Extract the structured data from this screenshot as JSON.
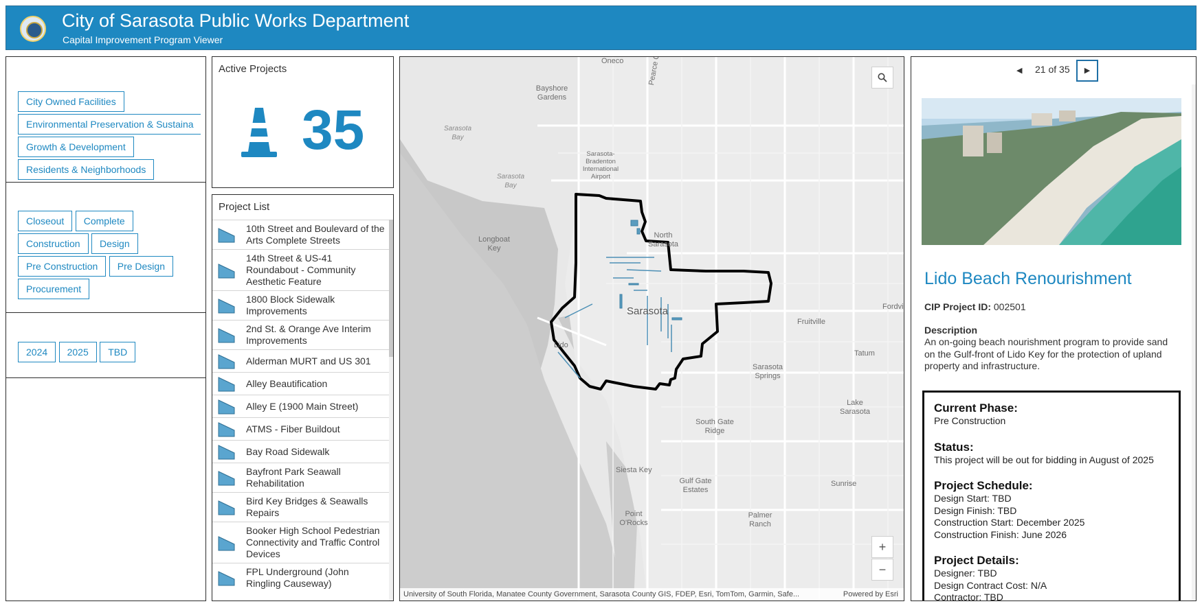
{
  "header": {
    "title": "City of Sarasota Public Works Department",
    "subtitle": "Capital Improvement Program Viewer"
  },
  "filters": {
    "category": [
      "City Owned Facilities",
      "Environmental Preservation & Sustaina",
      "Growth & Development",
      "Residents & Neighborhoods"
    ],
    "phase_rows": [
      [
        "Closeout",
        "Complete"
      ],
      [
        "Construction",
        "Design"
      ],
      [
        "Pre Construction",
        "Pre Design"
      ],
      [
        "Procurement"
      ]
    ],
    "year": [
      "2024",
      "2025",
      "TBD"
    ]
  },
  "active_projects": {
    "title": "Active Projects",
    "count": "35",
    "icon": "traffic-cone-icon",
    "accent": "#1e88c1"
  },
  "project_list": {
    "title": "Project List",
    "items": [
      "10th Street and Boulevard of the Arts Complete Streets",
      "14th Street & US-41 Roundabout - Community Aesthetic Feature",
      "1800 Block Sidewalk Improvements",
      "2nd St. & Orange Ave Interim Improvements",
      "Alderman MURT and US 301",
      "Alley Beautification",
      "Alley E (1900 Main Street)",
      "ATMS - Fiber Buildout",
      "Bay Road Sidewalk",
      "Bayfront Park Seawall Rehabilitation",
      "Bird Key Bridges & Seawalls Repairs",
      "Booker High School Pedestrian Connectivity and Traffic Control Devices",
      "FPL Underground (John Ringling Causeway)"
    ]
  },
  "map": {
    "labels": {
      "oneco": "Oneco",
      "bayshore": "Bayshore Gardens",
      "sarasota_bay_n": "Sarasota Bay",
      "peace_canal": "Pearce Canal",
      "airport": "Sarasota-Bradenton International Airport",
      "sarasota_bay": "Sarasota Bay",
      "longboat": "Longboat Key",
      "north_sarasota": "North Sarasota",
      "sarasota": "Sarasota",
      "fruitville": "Fruitville",
      "fordville": "Fordvi",
      "lido": "Lido",
      "tatum": "Tatum",
      "sarasota_springs": "Sarasota Springs",
      "lake_sarasota": "Lake Sarasota",
      "south_gate": "South Gate Ridge",
      "siesta": "Siesta Key",
      "gulf_gate": "Gulf Gate Estates",
      "sunrise": "Sunrise",
      "point_orocks": "Point O'Rocks",
      "palmer": "Palmer Ranch"
    },
    "attribution": "University of South Florida, Manatee County Government, Sarasota County GIS, FDEP, Esri, TomTom, Garmin, Safe...",
    "powered_by": "Powered by Esri",
    "zoom_in": "+",
    "zoom_out": "−"
  },
  "detail": {
    "pager_text": "21 of 35",
    "title": "Lido Beach Renourishment",
    "cip_label": "CIP Project ID:",
    "cip_value": "002501",
    "description_label": "Description",
    "description": "An on-going beach nourishment program to provide sand on the Gulf-front of Lido Key for the protection of upland property and infrastructure.",
    "current_phase_label": "Current Phase:",
    "current_phase": "Pre Construction",
    "status_label": "Status:",
    "status": "This project will be out for bidding in August of 2025",
    "schedule_label": "Project Schedule:",
    "schedule": [
      "Design Start: TBD",
      "Design Finish: TBD",
      "Construction Start: December 2025",
      "Construction Finish: June 2026"
    ],
    "details_label": "Project Details:",
    "details": [
      "Designer: TBD",
      "Design Contract Cost: N/A",
      "Contractor: TBD"
    ]
  }
}
